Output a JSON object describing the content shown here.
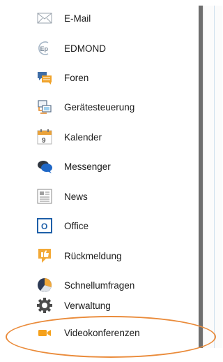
{
  "menu": {
    "items": [
      {
        "label": "E-Mail",
        "icon": "envelope-icon"
      },
      {
        "label": "EDMOND",
        "icon": "edmond-logo-icon"
      },
      {
        "label": "Foren",
        "icon": "forum-icon"
      },
      {
        "label": "Gerätesteuerung",
        "icon": "device-control-icon"
      },
      {
        "label": "Kalender",
        "icon": "calendar-icon"
      },
      {
        "label": "Messenger",
        "icon": "chat-bubbles-icon"
      },
      {
        "label": "News",
        "icon": "newspaper-icon"
      },
      {
        "label": "Office",
        "icon": "office-icon"
      },
      {
        "label": "Rückmeldung",
        "icon": "feedback-icon"
      },
      {
        "label": "Schnellumfragen",
        "icon": "pie-chart-icon"
      },
      {
        "label": "Verwaltung",
        "icon": "gear-icon"
      },
      {
        "label": "Videokonferenzen",
        "icon": "video-camera-icon"
      }
    ]
  },
  "calendar_icon_day": "9",
  "edmond_icon_text": "Ep",
  "office_icon_letter": "O",
  "colors": {
    "highlight": "#ea8b3a",
    "calendar_accent": "#e9a23b",
    "forum_orange": "#f0a32a",
    "office_blue": "#1e5fa8",
    "video_orange": "#f5a11c"
  }
}
